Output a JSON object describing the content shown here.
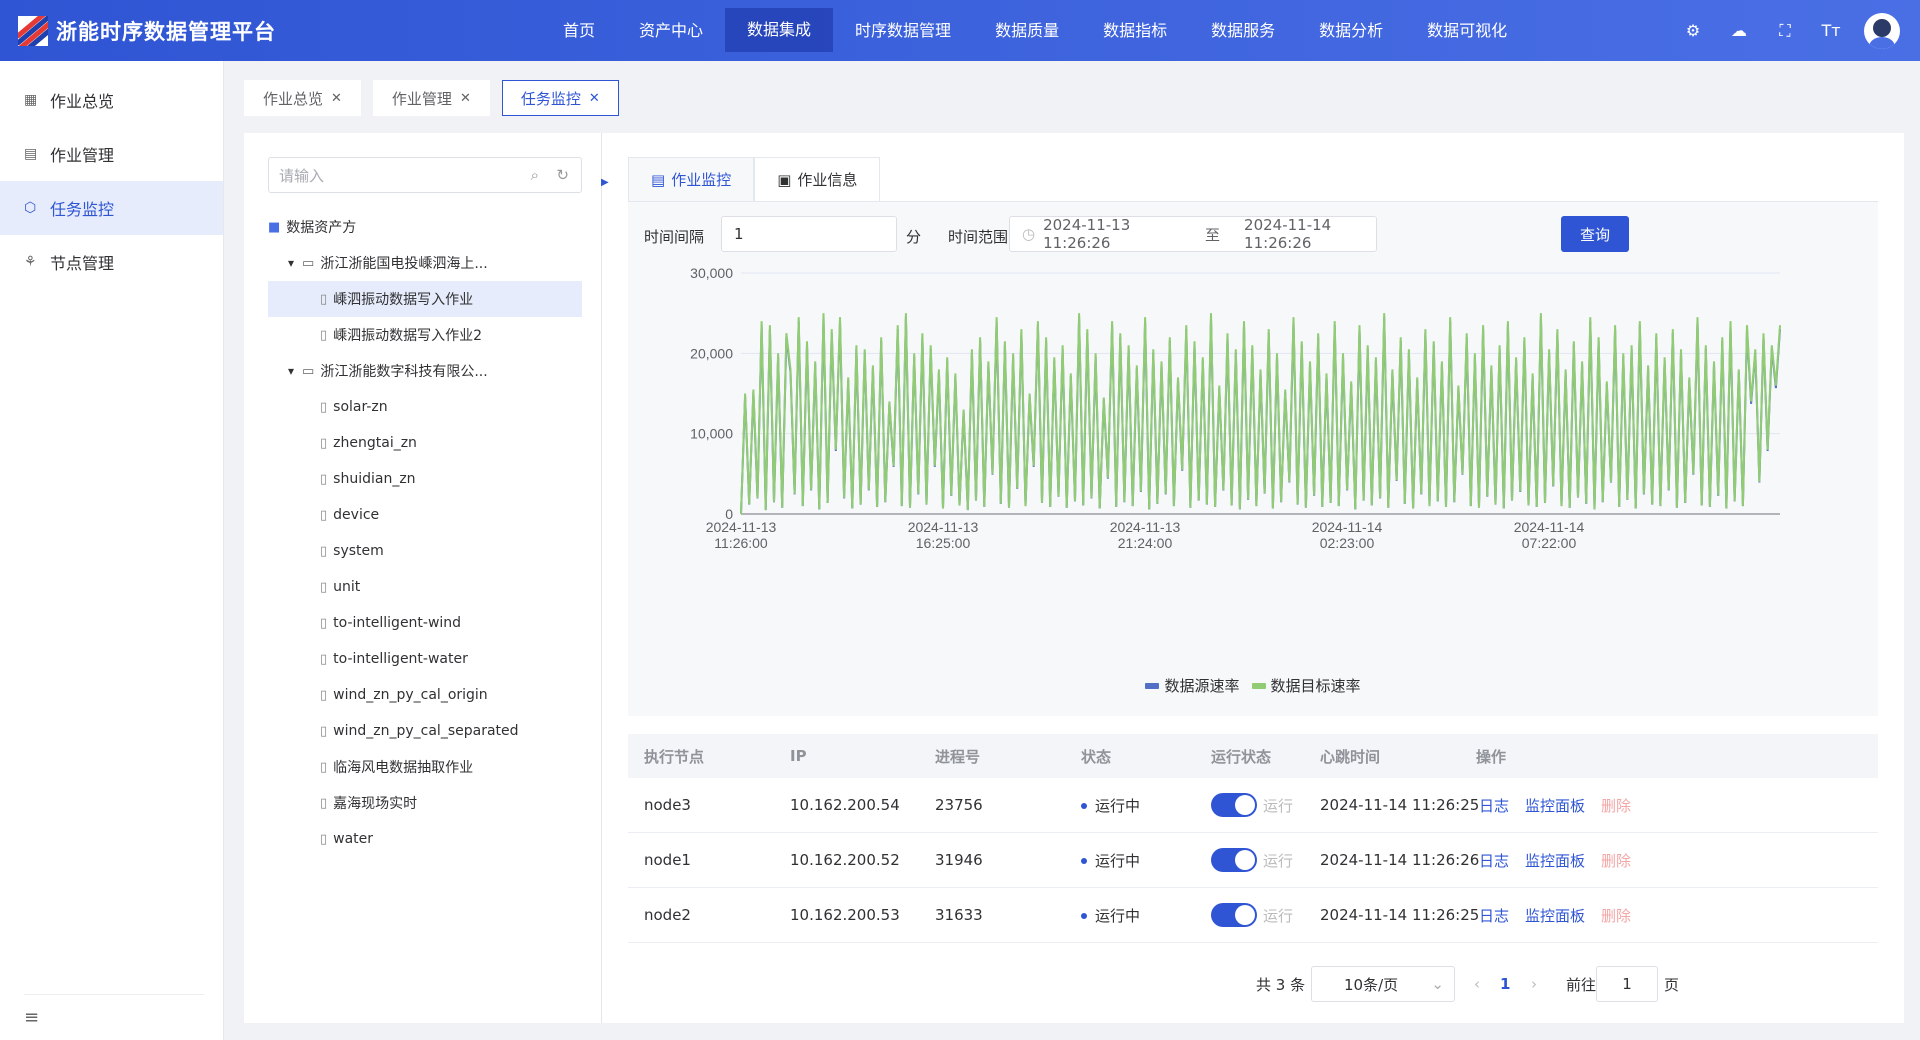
{
  "app": {
    "title": "浙能时序数据管理平台"
  },
  "nav": [
    "首页",
    "资产中心",
    "数据集成",
    "时序数据管理",
    "数据质量",
    "数据指标",
    "数据服务",
    "数据分析",
    "数据可视化"
  ],
  "top_icons": {
    "settings": "⚙",
    "cloud": "☁",
    "fullscreen": "⛶",
    "font": "Tт"
  },
  "sidebar": {
    "items": [
      "作业总览",
      "作业管理",
      "任务监控",
      "节点管理"
    ],
    "icons": [
      "▦",
      "▤",
      "⬡",
      "⚘"
    ],
    "bottom": "≡"
  },
  "tabs": [
    "作业总览",
    "作业管理",
    "任务监控"
  ],
  "tree": {
    "search_placeholder": "请输入",
    "root": "数据资产方",
    "group1": "浙江浙能国电投嵊泗海上...",
    "group1_items": [
      "嵊泗振动数据写入作业",
      "嵊泗振动数据写入作业2"
    ],
    "group2": "浙江浙能数字科技有限公...",
    "group2_items": [
      "solar-zn",
      "zhengtai_zn",
      "shuidian_zn",
      "device",
      "system",
      "unit",
      "to-intelligent-wind",
      "to-intelligent-water",
      "wind_zn_py_cal_origin",
      "wind_zn_py_cal_separated",
      "临海风电数据抽取作业",
      "嘉海现场实时",
      "water"
    ]
  },
  "main_tabs": [
    "作业监控",
    "作业信息"
  ],
  "filter": {
    "interval_label": "时间间隔",
    "interval_value": "1",
    "interval_unit": "分",
    "range_label": "时间范围",
    "start": "2024-11-13 11:26:26",
    "sep": "至",
    "end": "2024-11-14 11:26:26",
    "query": "查询"
  },
  "chart_data": {
    "type": "line",
    "ylim": [
      0,
      30000
    ],
    "yticks": [
      "30,000",
      "20,000",
      "10,000",
      "0"
    ],
    "xticks": [
      [
        "2024-11-13",
        "11:26:00"
      ],
      [
        "2024-11-13",
        "16:25:00"
      ],
      [
        "2024-11-13",
        "21:24:00"
      ],
      [
        "2024-11-14",
        "02:23:00"
      ],
      [
        "2024-11-14",
        "07:22:00"
      ]
    ],
    "series": [
      {
        "name": "数据源速率",
        "color": "#5470c6"
      },
      {
        "name": "数据目标速率",
        "color": "#91cc75"
      }
    ],
    "values": [
      0,
      15000,
      1200,
      15500,
      2000,
      24000,
      500,
      23500,
      1500,
      20000,
      800,
      22500,
      18000,
      2500,
      24500,
      1000,
      21500,
      3000,
      19000,
      600,
      25000,
      1400,
      23000,
      8000,
      24500,
      2000,
      17000,
      700,
      21000,
      1200,
      20500,
      3000,
      18500,
      900,
      22000,
      1500,
      14000,
      6000,
      23500,
      1000,
      25000,
      800,
      20000,
      2500,
      22500,
      1200,
      21000,
      6000,
      18000,
      700,
      19500,
      2300,
      17500,
      1100,
      13000,
      500,
      20500,
      1700,
      22000,
      900,
      19000,
      5000,
      24500,
      1300,
      21500,
      800,
      20000,
      3200,
      23000,
      1000,
      15000,
      6000,
      24000,
      1400,
      22000,
      900,
      19500,
      2200,
      21000,
      800,
      17500,
      1600,
      25000,
      1100,
      23000,
      2000,
      20000,
      700,
      14500,
      4500,
      24000,
      900,
      22500,
      1500,
      21000,
      1000,
      18500,
      2800,
      24500,
      600,
      20500,
      1300,
      19000,
      2500,
      22000,
      1000,
      17000,
      5500,
      23500,
      800,
      21500,
      1700,
      19500,
      1200,
      25000,
      900,
      16000,
      3000,
      22500,
      1100,
      20500,
      600,
      24000,
      1800,
      21000,
      1000,
      18000,
      2600,
      23000,
      700,
      20000,
      1500,
      15500,
      4000,
      24500,
      1200,
      21500,
      800,
      19000,
      2300,
      22500,
      900,
      17500,
      1400,
      24000,
      1000,
      20000,
      3000,
      16500,
      600,
      23500,
      1700,
      21000,
      1100,
      19500,
      2000,
      25000,
      800,
      18000,
      4200,
      22000,
      1300,
      20500,
      700,
      17000,
      2500,
      23000,
      1000,
      21500,
      1600,
      19000,
      900,
      24500,
      1500,
      16000,
      5000,
      22500,
      1000,
      20000,
      800,
      23500,
      2200,
      18500,
      1200,
      21000,
      700,
      24000,
      1700,
      19500,
      2800,
      22000,
      1100,
      17500,
      900,
      25000,
      1400,
      20500,
      3500,
      23000,
      1000,
      18000,
      800,
      21500,
      2100,
      19000,
      1300,
      24500,
      600,
      22000,
      1500,
      16500,
      4000,
      23500,
      900,
      20000,
      1800,
      21000,
      700,
      24000,
      2500,
      18500,
      1200,
      22500,
      1000,
      19500,
      3000,
      23000,
      800,
      20500,
      1400,
      17000,
      5000,
      24500,
      1100,
      21000,
      900,
      19000,
      2300,
      22000,
      700,
      24000,
      1600,
      18000,
      1000,
      23500,
      14000,
      20500,
      4000,
      22500,
      8000,
      21000,
      16000,
      23500
    ]
  },
  "table": {
    "headers": [
      "执行节点",
      "IP",
      "进程号",
      "状态",
      "运行状态",
      "心跳时间",
      "操作"
    ],
    "rows": [
      {
        "node": "node3",
        "ip": "10.162.200.54",
        "pid": "23756",
        "status": "运行中",
        "run": "运行",
        "hb": "2024-11-14 11:26:25"
      },
      {
        "node": "node1",
        "ip": "10.162.200.52",
        "pid": "31946",
        "status": "运行中",
        "run": "运行",
        "hb": "2024-11-14 11:26:26"
      },
      {
        "node": "node2",
        "ip": "10.162.200.53",
        "pid": "31633",
        "status": "运行中",
        "run": "运行",
        "hb": "2024-11-14 11:26:25"
      }
    ],
    "actions": [
      "日志",
      "监控面板",
      "删除"
    ]
  },
  "pager": {
    "total": "共 3 条",
    "size": "10条/页",
    "page": "1",
    "goto": "前往",
    "goto_value": "1",
    "page_unit": "页",
    "prev": "‹",
    "next": "›"
  }
}
